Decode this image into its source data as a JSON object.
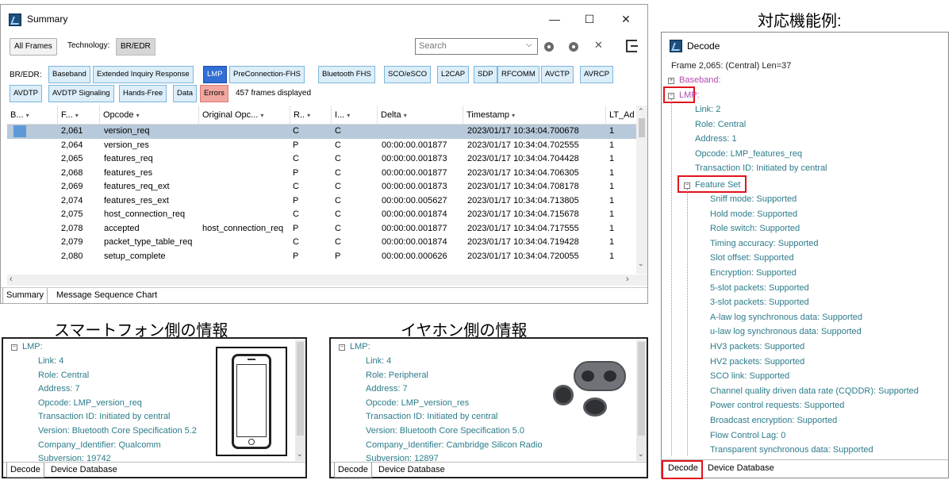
{
  "summary_window": {
    "title": "Summary",
    "minimize": "—",
    "maximize": "☐",
    "close": "✕",
    "all_frames": "All Frames",
    "technology_label": "Technology:",
    "technology_value": "BR/EDR",
    "search_placeholder": "Search",
    "search_clear": "✕",
    "br_edr_label": "BR/EDR:",
    "tabs_row1": [
      "Baseband",
      "Extended Inquiry Response",
      "LMP",
      "PreConnection-FHS",
      "Bluetooth FHS",
      "SCO/eSCO",
      "L2CAP",
      "SDP",
      "RFCOMM",
      "AVCTP",
      "AVRCP"
    ],
    "tabs_row2": [
      "AVDTP",
      "AVDTP Signaling",
      "Hands-Free",
      "Data",
      "Errors"
    ],
    "frames_displayed": "457 frames displayed",
    "columns": [
      "B...",
      "F...",
      "Opcode",
      "Original Opc...",
      "R..",
      "I...",
      "Delta",
      "Timestamp",
      "LT_Ad"
    ],
    "rows": [
      {
        "frame": "2,061",
        "opcode": "version_req",
        "orig": "",
        "r": "C",
        "i": "C",
        "delta": "",
        "ts": "2023/01/17 10:34:04.700678",
        "lt": "1"
      },
      {
        "frame": "2,064",
        "opcode": "version_res",
        "orig": "",
        "r": "P",
        "i": "C",
        "delta": "00:00:00.001877",
        "ts": "2023/01/17 10:34:04.702555",
        "lt": "1"
      },
      {
        "frame": "2,065",
        "opcode": "features_req",
        "orig": "",
        "r": "C",
        "i": "C",
        "delta": "00:00:00.001873",
        "ts": "2023/01/17 10:34:04.704428",
        "lt": "1"
      },
      {
        "frame": "2,068",
        "opcode": "features_res",
        "orig": "",
        "r": "P",
        "i": "C",
        "delta": "00:00:00.001877",
        "ts": "2023/01/17 10:34:04.706305",
        "lt": "1"
      },
      {
        "frame": "2,069",
        "opcode": "features_req_ext",
        "orig": "",
        "r": "C",
        "i": "C",
        "delta": "00:00:00.001873",
        "ts": "2023/01/17 10:34:04.708178",
        "lt": "1"
      },
      {
        "frame": "2,074",
        "opcode": "features_res_ext",
        "orig": "",
        "r": "P",
        "i": "C",
        "delta": "00:00:00.005627",
        "ts": "2023/01/17 10:34:04.713805",
        "lt": "1"
      },
      {
        "frame": "2,075",
        "opcode": "host_connection_req",
        "orig": "",
        "r": "C",
        "i": "C",
        "delta": "00:00:00.001874",
        "ts": "2023/01/17 10:34:04.715678",
        "lt": "1"
      },
      {
        "frame": "2,078",
        "opcode": "accepted",
        "orig": "host_connection_req",
        "r": "P",
        "i": "C",
        "delta": "00:00:00.001877",
        "ts": "2023/01/17 10:34:04.717555",
        "lt": "1"
      },
      {
        "frame": "2,079",
        "opcode": "packet_type_table_req",
        "orig": "",
        "r": "C",
        "i": "C",
        "delta": "00:00:00.001874",
        "ts": "2023/01/17 10:34:04.719428",
        "lt": "1"
      },
      {
        "frame": "2,080",
        "opcode": "setup_complete",
        "orig": "",
        "r": "P",
        "i": "P",
        "delta": "00:00:00.000626",
        "ts": "2023/01/17 10:34:04.720055",
        "lt": "1"
      }
    ],
    "bottom_tabs": [
      "Summary",
      "Message Sequence Chart"
    ]
  },
  "heading_right": "対応機能例:",
  "heading_smartphone": "スマートフォン側の情報",
  "heading_earphone": "イヤホン側の情報",
  "smartphone_panel": {
    "root": "LMP:",
    "lines": [
      "Link: 4",
      "Role: Central",
      "Address: 7",
      "Opcode: LMP_version_req",
      "Transaction ID: Initiated by central",
      "Version: Bluetooth Core Specification 5.2",
      "Company_Identifier: Qualcomm",
      "Subversion: 19742"
    ],
    "tabs": [
      "Decode",
      "Device Database"
    ]
  },
  "earphone_panel": {
    "root": "LMP:",
    "lines": [
      "Link: 4",
      "Role: Peripheral",
      "Address: 7",
      "Opcode: LMP_version_res",
      "Transaction ID: Initiated by central",
      "Version: Bluetooth Core Specification 5.0",
      "Company_Identifier: Cambridge Silicon Radio",
      "Subversion: 12897"
    ],
    "tabs": [
      "Decode",
      "Device Database"
    ]
  },
  "decode_window": {
    "title": "Decode",
    "frame_line": "Frame 2,065: (Central) Len=37",
    "baseband": "Baseband:",
    "lmp": "LMP:",
    "lmp_lines": [
      "Link: 2",
      "Role: Central",
      "Address: 1",
      "Opcode: LMP_features_req",
      "Transaction ID: Initiated by central"
    ],
    "feature_set": "Feature Set",
    "features": [
      "Sniff mode: Supported",
      "Hold mode: Supported",
      "Role switch: Supported",
      "Timing accuracy: Supported",
      "Slot offset: Supported",
      "Encryption: Supported",
      "5-slot packets: Supported",
      "3-slot packets: Supported",
      "A-law log synchronous data: Supported",
      "u-law log synchronous data: Supported",
      "HV3 packets: Supported",
      "HV2 packets: Supported",
      "SCO link: Supported",
      "Channel quality driven data rate (CQDDR): Supported",
      "Power control requests: Supported",
      "Broadcast encryption: Supported",
      "Flow Control Lag: 0",
      "Transparent synchronous data: Supported"
    ],
    "tabs": [
      "Decode",
      "Device Database"
    ]
  },
  "colors": {
    "accent": "#2f6fd6",
    "tree_text": "#2c7c8a",
    "highlight_box": "#e0141e",
    "selected_row": "#b7c9da"
  }
}
